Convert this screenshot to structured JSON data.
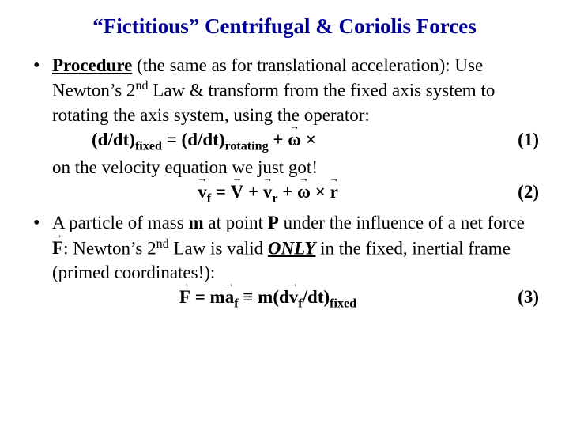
{
  "title": "“Fictitious” Centrifugal & Coriolis Forces",
  "bullet1": {
    "lead": "Procedure",
    "tail": " (the same as for translational acceleration): Use Newton’s 2",
    "nd": "nd",
    "tail2": " Law & transform from the fixed axis system to rotating the axis system, using the operator:",
    "eq1_a": "(d/dt)",
    "eq1_sub1": "fixed",
    "eq1_b": " = (d/dt)",
    "eq1_sub2": "rotating",
    "eq1_c": " + ",
    "eq1_omega": "ω",
    "eq1_d": " ×",
    "eq1_num": "(1)",
    "line_after1": "on the velocity equation we just got!",
    "eq2_vf": "v",
    "eq2_vfsub": "f",
    "eq2_eq": " = ",
    "eq2_V": "V",
    "eq2_plus1": " + ",
    "eq2_vr": "v",
    "eq2_vrsub": "r",
    "eq2_plus2": " + ",
    "eq2_omega": "ω",
    "eq2_cross": " × ",
    "eq2_r": "r",
    "eq2_num": "(2)"
  },
  "bullet2": {
    "a": "A particle of mass ",
    "m": "m",
    "b": " at point ",
    "P": "P",
    "c": " under the influence of a net force ",
    "F": "F",
    "d": ": Newton’s 2",
    "nd": "nd",
    "e": " Law is valid ",
    "only": "ONLY",
    "f": " in the fixed, inertial frame (primed coordinates!):",
    "eq3_F": "F",
    "eq3_eq1": " = m",
    "eq3_a": "a",
    "eq3_asub": "f",
    "eq3_ident": " ≡ m(d",
    "eq3_v": "v",
    "eq3_vsub": "f",
    "eq3_tail": "/dt)",
    "eq3_sub": "fixed",
    "eq3_num": "(3)"
  }
}
